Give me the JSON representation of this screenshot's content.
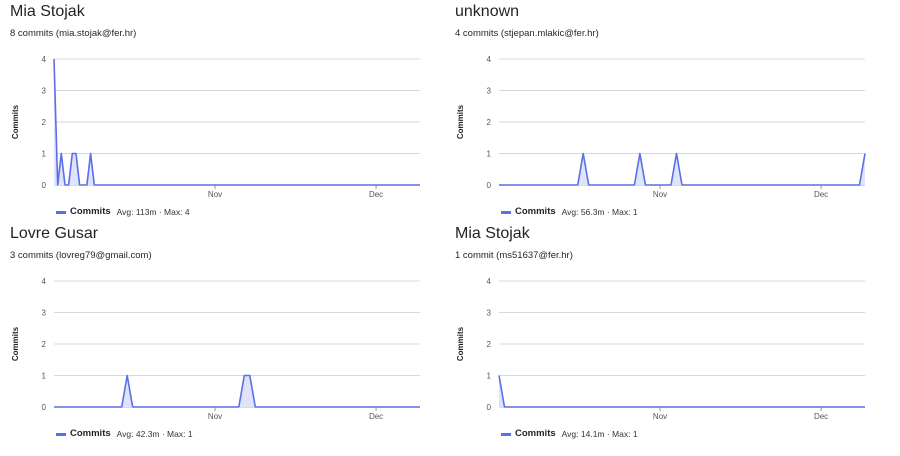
{
  "colors": {
    "line": "#5b6fe6",
    "fill": "#dfe3fb",
    "grid": "#d8d8d8"
  },
  "chart_data": [
    {
      "type": "area",
      "title": "Mia Stojak",
      "subtitle": "8 commits (mia.stojak@fer.hr)",
      "ylabel": "Commits",
      "ylim": [
        0,
        4
      ],
      "yticks": [
        0,
        1,
        2,
        3,
        4
      ],
      "x_range_days": [
        0,
        100
      ],
      "xticks": [
        {
          "label": "Nov",
          "day": 44
        },
        {
          "label": "Dec",
          "day": 88
        }
      ],
      "series": [
        {
          "name": "Commits",
          "x": [
            0,
            1,
            2,
            3,
            4,
            5,
            6,
            7,
            8,
            9,
            10,
            11,
            12,
            13,
            14,
            15,
            100
          ],
          "values": [
            4,
            0,
            1,
            0,
            0,
            1,
            1,
            0,
            0,
            0,
            1,
            0,
            0,
            0,
            0,
            0,
            0
          ]
        }
      ],
      "legend": {
        "label": "Commits",
        "stats": "Avg: 113m · Max: 4"
      }
    },
    {
      "type": "area",
      "title": "unknown",
      "subtitle": "4 commits (stjepan.mlakic@fer.hr)",
      "ylabel": "Commits",
      "ylim": [
        0,
        4
      ],
      "yticks": [
        0,
        1,
        2,
        3,
        4
      ],
      "x_range_days": [
        0,
        100
      ],
      "xticks": [
        {
          "label": "Nov",
          "day": 44
        },
        {
          "label": "Dec",
          "day": 88
        }
      ],
      "series": [
        {
          "name": "Commits",
          "x": [
            0,
            21.5,
            23,
            24.5,
            37,
            38.5,
            40,
            47,
            48.5,
            50,
            98.5,
            100
          ],
          "values": [
            0,
            0,
            1,
            0,
            0,
            1,
            0,
            0,
            1,
            0,
            0,
            1
          ]
        }
      ],
      "legend": {
        "label": "Commits",
        "stats": "Avg: 56.3m · Max: 1"
      }
    },
    {
      "type": "area",
      "title": "Lovre Gusar",
      "subtitle": "3 commits (lovreg79@gmail.com)",
      "ylabel": "Commits",
      "ylim": [
        0,
        4
      ],
      "yticks": [
        0,
        1,
        2,
        3,
        4
      ],
      "x_range_days": [
        0,
        100
      ],
      "xticks": [
        {
          "label": "Nov",
          "day": 44
        },
        {
          "label": "Dec",
          "day": 88
        }
      ],
      "series": [
        {
          "name": "Commits",
          "x": [
            0,
            18.5,
            20,
            21.5,
            50.5,
            52,
            53.5,
            55,
            100
          ],
          "values": [
            0,
            0,
            1,
            0,
            0,
            1,
            1,
            0,
            0
          ]
        }
      ],
      "legend": {
        "label": "Commits",
        "stats": "Avg: 42.3m · Max: 1"
      }
    },
    {
      "type": "area",
      "title": "Mia Stojak",
      "subtitle": "1 commit (ms51637@fer.hr)",
      "ylabel": "Commits",
      "ylim": [
        0,
        4
      ],
      "yticks": [
        0,
        1,
        2,
        3,
        4
      ],
      "x_range_days": [
        0,
        100
      ],
      "xticks": [
        {
          "label": "Nov",
          "day": 44
        },
        {
          "label": "Dec",
          "day": 88
        }
      ],
      "series": [
        {
          "name": "Commits",
          "x": [
            0,
            1.5,
            100
          ],
          "values": [
            1,
            0,
            0
          ]
        }
      ],
      "legend": {
        "label": "Commits",
        "stats": "Avg: 14.1m · Max: 1"
      }
    }
  ]
}
